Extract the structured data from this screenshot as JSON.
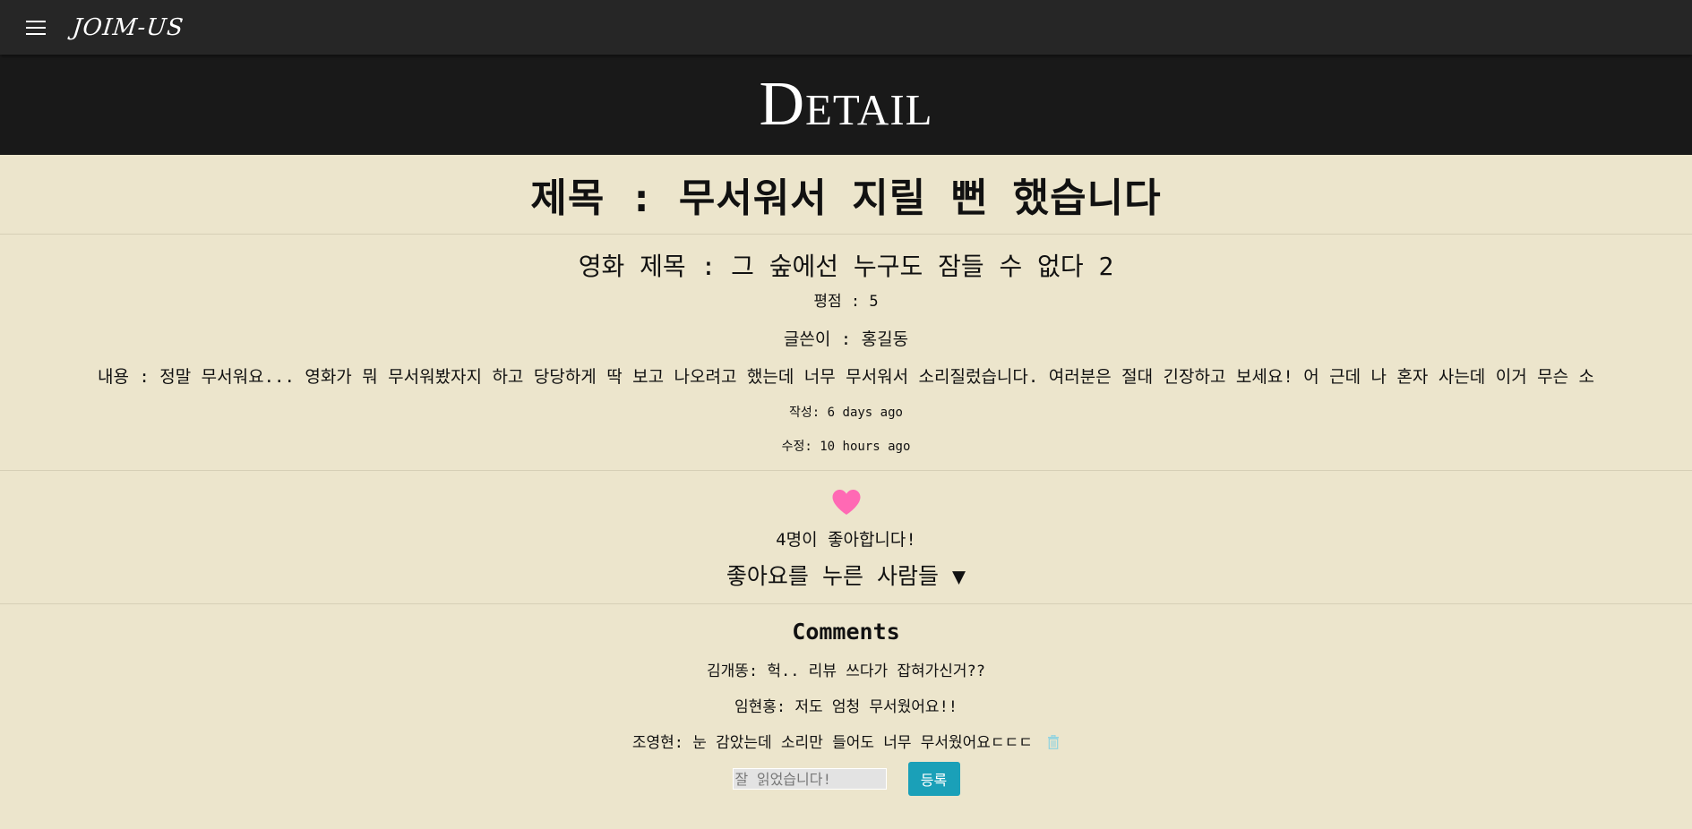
{
  "nav": {
    "brand": "JOIM-US"
  },
  "hero": {
    "title": "Detail"
  },
  "post": {
    "title": "제목 : 무서워서 지릴 뻔 했습니다",
    "movie_title": "영화 제목 : 그 숲에선 누구도 잠들 수 없다 2",
    "rating": "평점 : 5",
    "author": "글쓴이 : 홍길동",
    "content": "내용 : 정말 무서워요... 영화가 뭐 무서워봤자지 하고 당당하게 딱 보고 나오려고 했는데 너무 무서워서 소리질렀습니다. 여러분은 절대 긴장하고 보세요! 어 근데 나 혼자 사는데 이거 무슨 소",
    "created": "작성: 6 days ago",
    "modified": "수정: 10 hours ago"
  },
  "likes": {
    "count_text": "4명이 좋아합니다!",
    "likers_toggle": "좋아요를 누른 사람들 ▼",
    "heart_color": "#ff69b4"
  },
  "comments": {
    "title": "Comments",
    "items": [
      {
        "text": "김개똥: 헉.. 리뷰 쓰다가 잡혀가신거??"
      },
      {
        "text": "임현홍: 저도 엄청 무서웠어요!!"
      },
      {
        "text": "조영현: 눈 감았는데 소리만 들어도 너무 무서웠어요ㄷㄷㄷ",
        "icon": "trash-icon"
      }
    ],
    "input_placeholder": "잘 읽었습니다!",
    "submit_label": "등록"
  },
  "colors": {
    "page_bg": "#ece5cc",
    "navbar_bg": "#262626",
    "hero_bg": "#191919",
    "button_bg": "#1aa0b8",
    "trash_icon": "#8fd3e0"
  }
}
